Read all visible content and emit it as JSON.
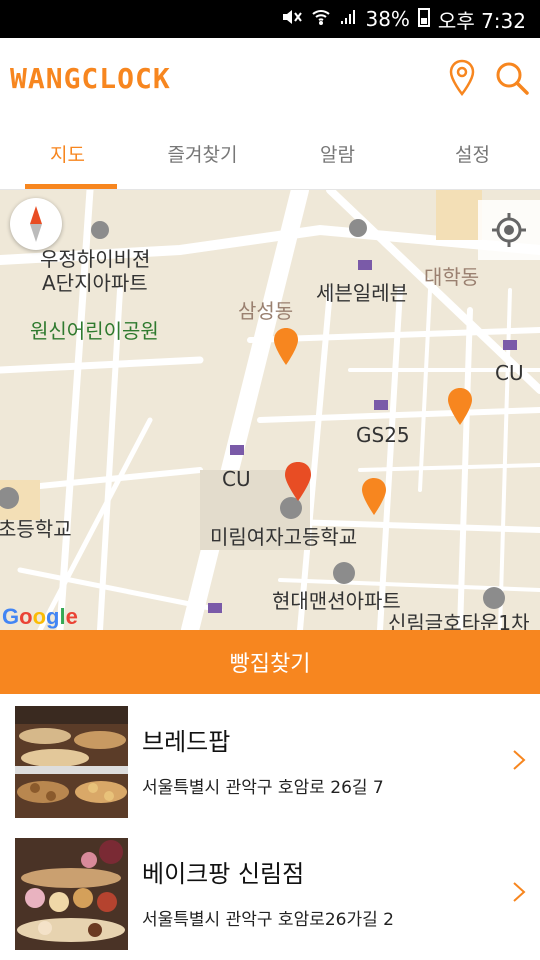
{
  "status": {
    "battery": "38%",
    "time": "오후 7:32"
  },
  "app": {
    "logo_text": "WANGCLOCK",
    "accent": "#f7861f"
  },
  "tabs": [
    {
      "label": "지도",
      "active": true
    },
    {
      "label": "즐겨찾기",
      "active": false
    },
    {
      "label": "알람",
      "active": false
    },
    {
      "label": "설정",
      "active": false
    }
  ],
  "map": {
    "labels": {
      "apt1_line1": "우정하이비젼",
      "apt1_line2": "A단지아파트",
      "park": "원신어린이공원",
      "district_samsung": "삼성동",
      "seven_eleven": "세븐일레븐",
      "district_daehak": "대학동",
      "cu_right": "CU",
      "gs25": "GS25",
      "cu_left": "CU",
      "school_left": "초등학교",
      "girls_high": "미림여자고등학교",
      "hyundai_apt": "현대맨션아파트",
      "sillim_town": "신림글호타운1차"
    },
    "google": "Google"
  },
  "search_button": {
    "label": "빵집찾기"
  },
  "bakeries": [
    {
      "name": "브레드팝",
      "address": "서울특별시 관악구 호암로 26길 7"
    },
    {
      "name": "베이크팡 신림점",
      "address": "서울특별시 관악구 호암로26가길 2"
    }
  ]
}
